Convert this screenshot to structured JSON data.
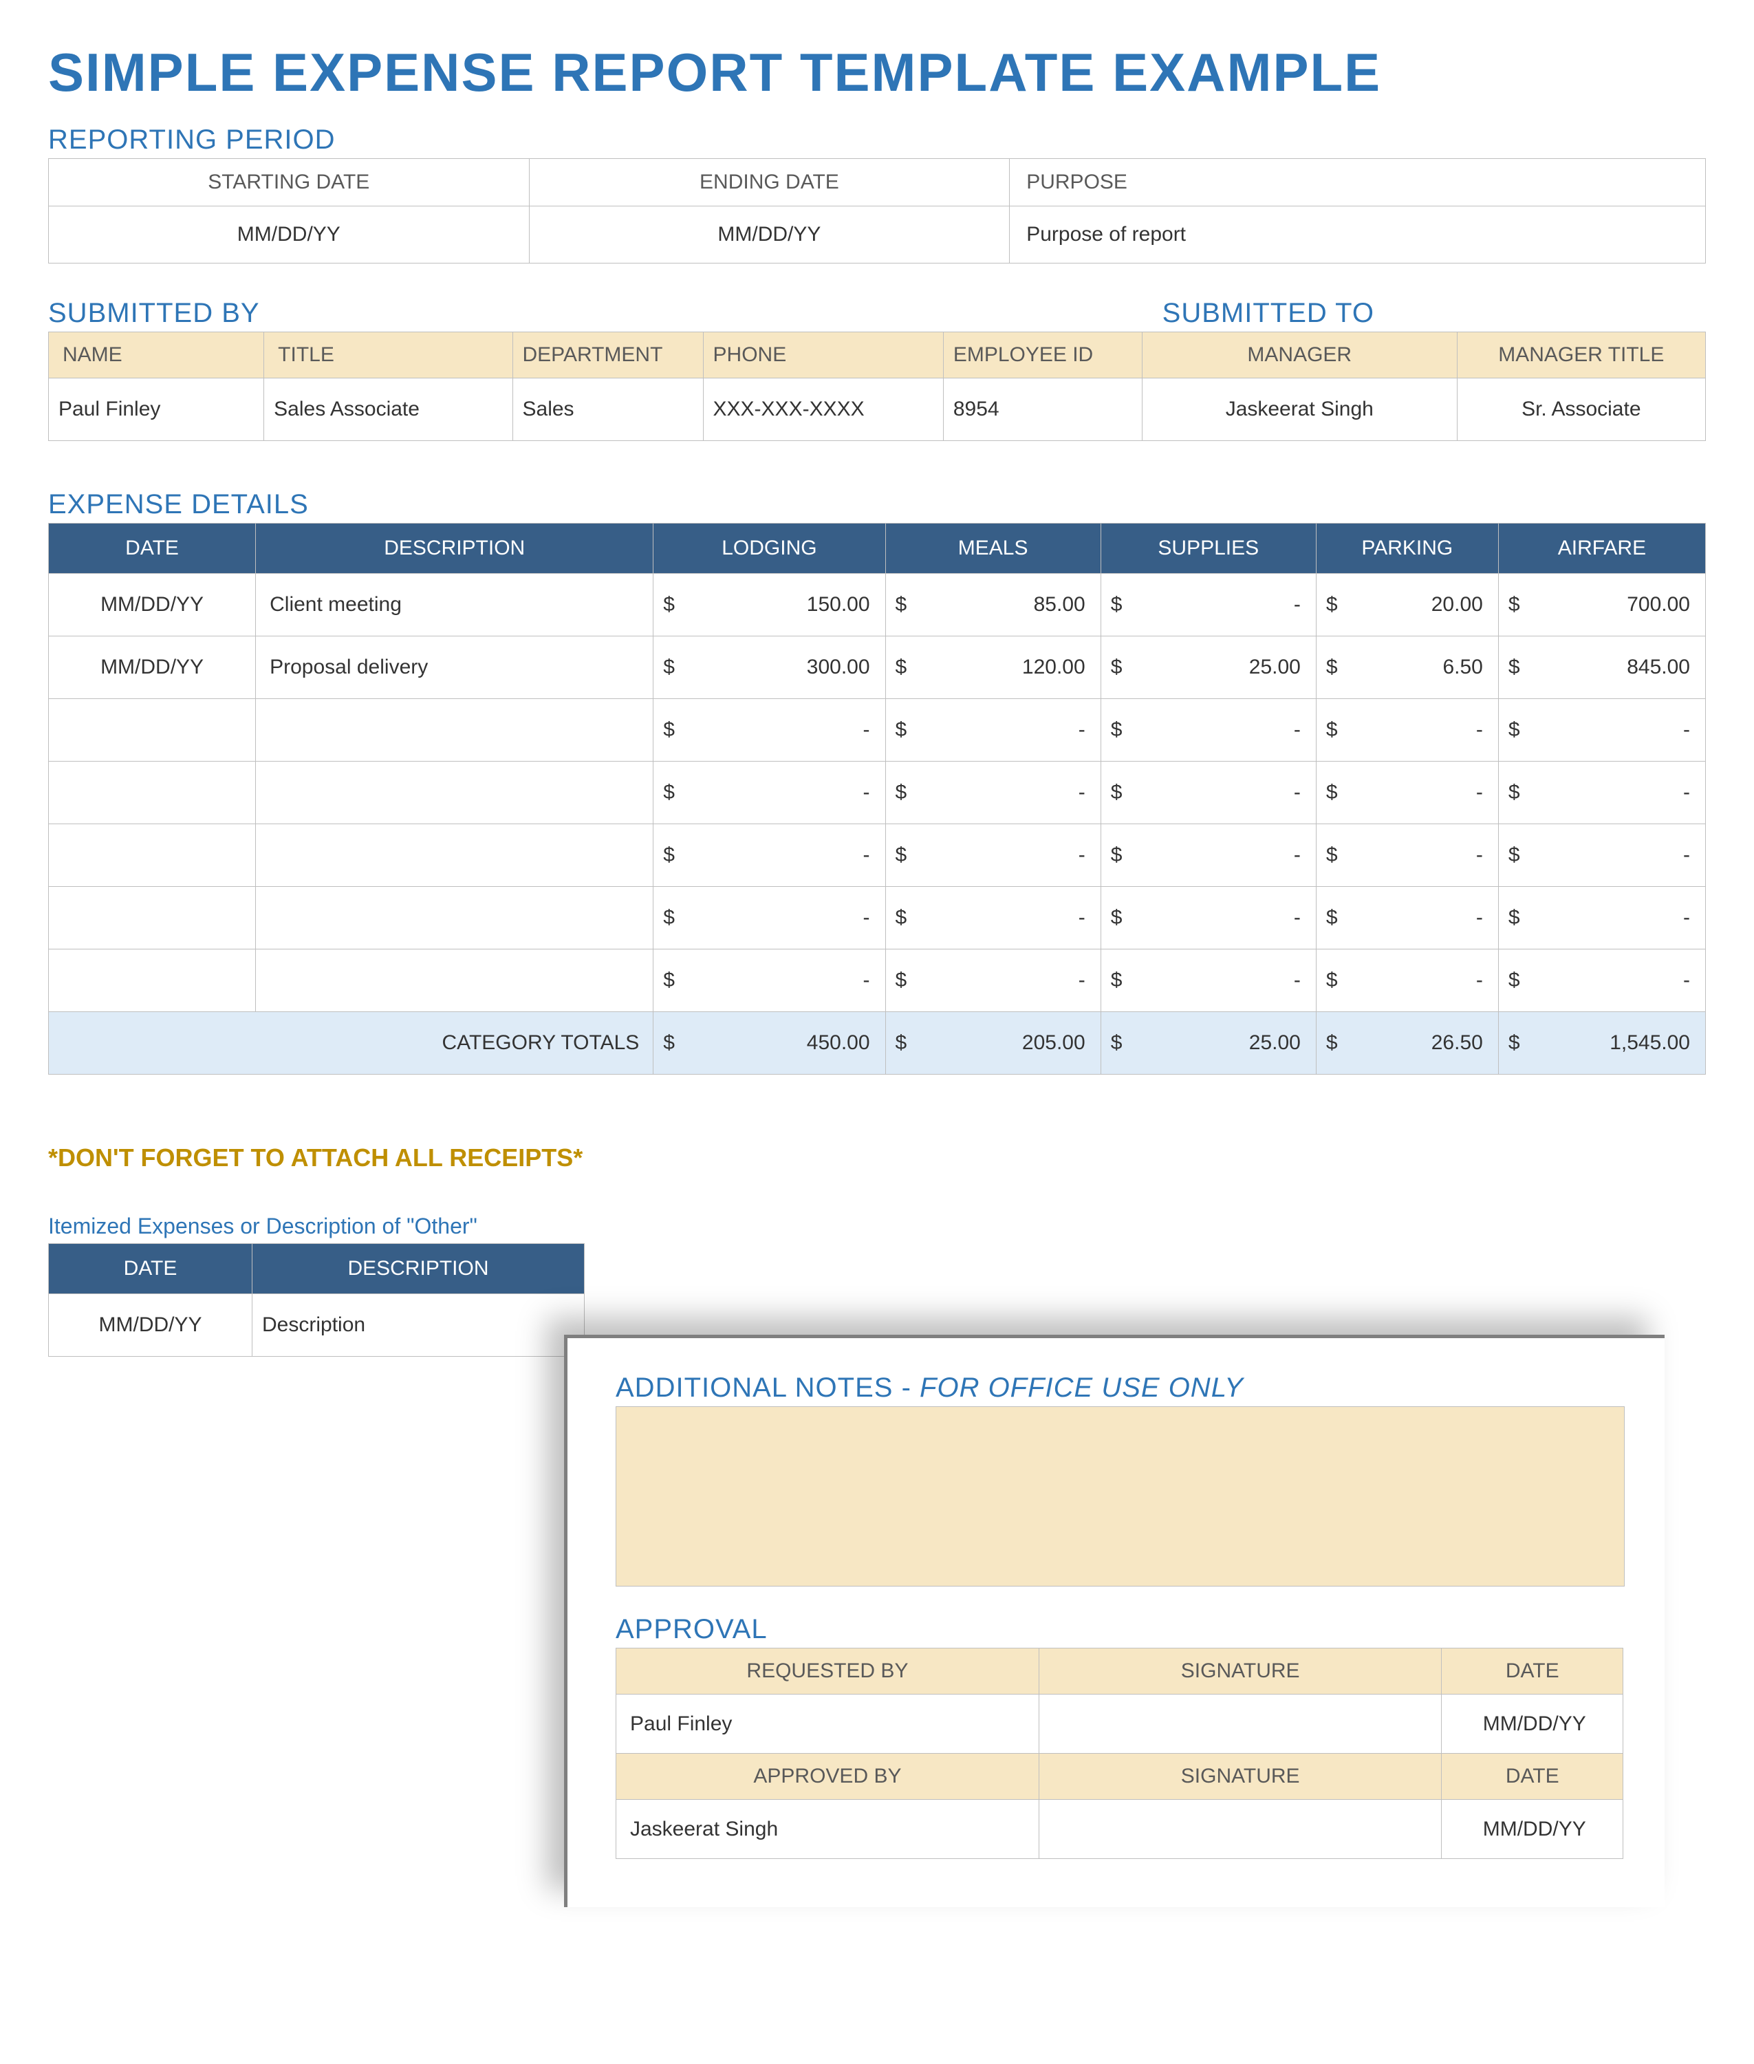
{
  "title": "SIMPLE EXPENSE REPORT TEMPLATE EXAMPLE",
  "sections": {
    "reporting": "REPORTING PERIOD",
    "submittedBy": "SUBMITTED BY",
    "submittedTo": "SUBMITTED TO",
    "expenseDetails": "EXPENSE DETAILS",
    "reminder": "*DON'T FORGET TO ATTACH ALL RECEIPTS*",
    "itemized": "Itemized Expenses or Description of \"Other\"",
    "notes": "ADDITIONAL NOTES - ",
    "notes_em": "FOR OFFICE USE ONLY",
    "approval": "APPROVAL"
  },
  "reportingPeriod": {
    "headers": {
      "start": "STARTING DATE",
      "end": "ENDING DATE",
      "purpose": "PURPOSE"
    },
    "start": "MM/DD/YY",
    "end": "MM/DD/YY",
    "purpose": "Purpose of report"
  },
  "submitted": {
    "headers": {
      "name": "NAME",
      "title": "TITLE",
      "dept": "DEPARTMENT",
      "phone": "PHONE",
      "eid": "EMPLOYEE ID",
      "manager": "MANAGER",
      "mtitle": "MANAGER TITLE"
    },
    "name": "Paul Finley",
    "title": "Sales Associate",
    "dept": "Sales",
    "phone": "XXX-XXX-XXXX",
    "eid": "8954",
    "manager": "Jaskeerat Singh",
    "mtitle": "Sr. Associate"
  },
  "expense": {
    "headers": {
      "date": "DATE",
      "desc": "DESCRIPTION",
      "lodging": "LODGING",
      "meals": "MEALS",
      "supplies": "SUPPLIES",
      "parking": "PARKING",
      "airfare": "AIRFARE"
    },
    "rows": [
      {
        "date": "MM/DD/YY",
        "desc": "Client meeting",
        "lodging": "150.00",
        "meals": "85.00",
        "supplies": "-",
        "parking": "20.00",
        "airfare": "700.00"
      },
      {
        "date": "MM/DD/YY",
        "desc": "Proposal delivery",
        "lodging": "300.00",
        "meals": "120.00",
        "supplies": "25.00",
        "parking": "6.50",
        "airfare": "845.00"
      },
      {
        "date": "",
        "desc": "",
        "lodging": "-",
        "meals": "-",
        "supplies": "-",
        "parking": "-",
        "airfare": "-"
      },
      {
        "date": "",
        "desc": "",
        "lodging": "-",
        "meals": "-",
        "supplies": "-",
        "parking": "-",
        "airfare": "-"
      },
      {
        "date": "",
        "desc": "",
        "lodging": "-",
        "meals": "-",
        "supplies": "-",
        "parking": "-",
        "airfare": "-"
      },
      {
        "date": "",
        "desc": "",
        "lodging": "-",
        "meals": "-",
        "supplies": "-",
        "parking": "-",
        "airfare": "-"
      },
      {
        "date": "",
        "desc": "",
        "lodging": "-",
        "meals": "-",
        "supplies": "-",
        "parking": "-",
        "airfare": "-"
      }
    ],
    "totalsLabel": "CATEGORY TOTALS",
    "totals": {
      "lodging": "450.00",
      "meals": "205.00",
      "supplies": "25.00",
      "parking": "26.50",
      "airfare": "1,545.00"
    }
  },
  "itemized": {
    "headers": {
      "date": "DATE",
      "desc": "DESCRIPTION"
    },
    "row": {
      "date": "MM/DD/YY",
      "desc": "Description"
    }
  },
  "approval": {
    "headers": {
      "req": "REQUESTED BY",
      "sig": "SIGNATURE",
      "date": "DATE",
      "app": "APPROVED BY"
    },
    "requested": {
      "name": "Paul Finley",
      "date": "MM/DD/YY"
    },
    "approved": {
      "name": "Jaskeerat Singh",
      "date": "MM/DD/YY"
    }
  }
}
